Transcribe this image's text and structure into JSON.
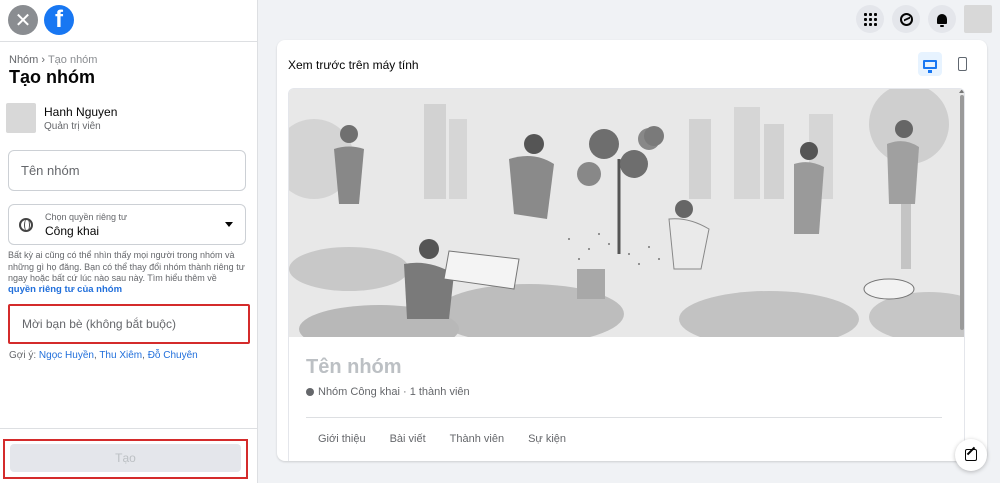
{
  "sidebar": {
    "breadcrumb": {
      "root": "Nhóm",
      "separator": "›",
      "current": "Tạo nhóm"
    },
    "title": "Tạo nhóm",
    "admin": {
      "name": "Hanh Nguyen",
      "role": "Quản trị viên"
    },
    "group_name_field": {
      "placeholder": "Tên nhóm"
    },
    "privacy": {
      "label": "Chọn quyền riêng tư",
      "value": "Công khai",
      "description": "Bất kỳ ai cũng có thể nhìn thấy mọi người trong nhóm và những gì họ đăng. Bạn có thể thay đổi nhóm thành riêng tư ngay hoặc bất cứ lúc nào sau này. Tìm hiểu thêm về",
      "link": "quyền riêng tư của nhóm"
    },
    "invite_field": {
      "placeholder": "Mời bạn bè (không bắt buộc)"
    },
    "suggestions": {
      "label": "Gợi ý:",
      "names": [
        "Ngọc Huyền",
        "Thu Xiêm",
        "Đỗ Chuyên"
      ]
    },
    "create_button": "Tạo"
  },
  "preview": {
    "title": "Xem trước trên máy tính",
    "group_name": "Tên nhóm",
    "group_meta": "Nhóm Công khai · 1 thành viên",
    "tabs": [
      "Giới thiệu",
      "Bài viết",
      "Thành viên",
      "Sự kiện"
    ]
  },
  "colors": {
    "accent": "#1877f2",
    "link": "#216fdb",
    "highlight_border": "#d42b2b"
  }
}
